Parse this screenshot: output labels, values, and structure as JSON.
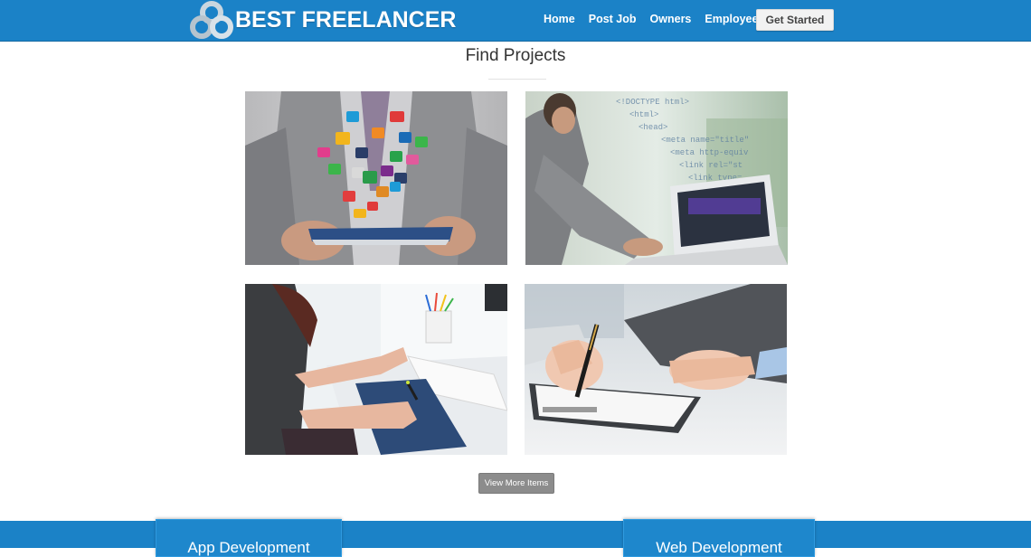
{
  "brand": {
    "name": "BEST FREELANCER",
    "logo_icon": "triple-ring-logo-icon"
  },
  "nav": {
    "items": [
      "Home",
      "Post Job",
      "Owners",
      "Employees"
    ],
    "cta_label": "Get Started"
  },
  "main": {
    "title": "Find Projects",
    "tiles": [
      {
        "image": "businessman-tablet-app-icons-photo"
      },
      {
        "image": "man-laptop-html-code-photo"
      },
      {
        "image": "woman-drawing-tablet-photo"
      },
      {
        "image": "hand-signing-clipboard-photo"
      }
    ],
    "view_more_label": "View More Items"
  },
  "services": {
    "cards": [
      "App Development",
      "Web Development"
    ]
  },
  "colors": {
    "brand_blue": "#1b82c7",
    "button_gray": "#8c8c8c",
    "cta_bg": "#f2f2f2"
  }
}
